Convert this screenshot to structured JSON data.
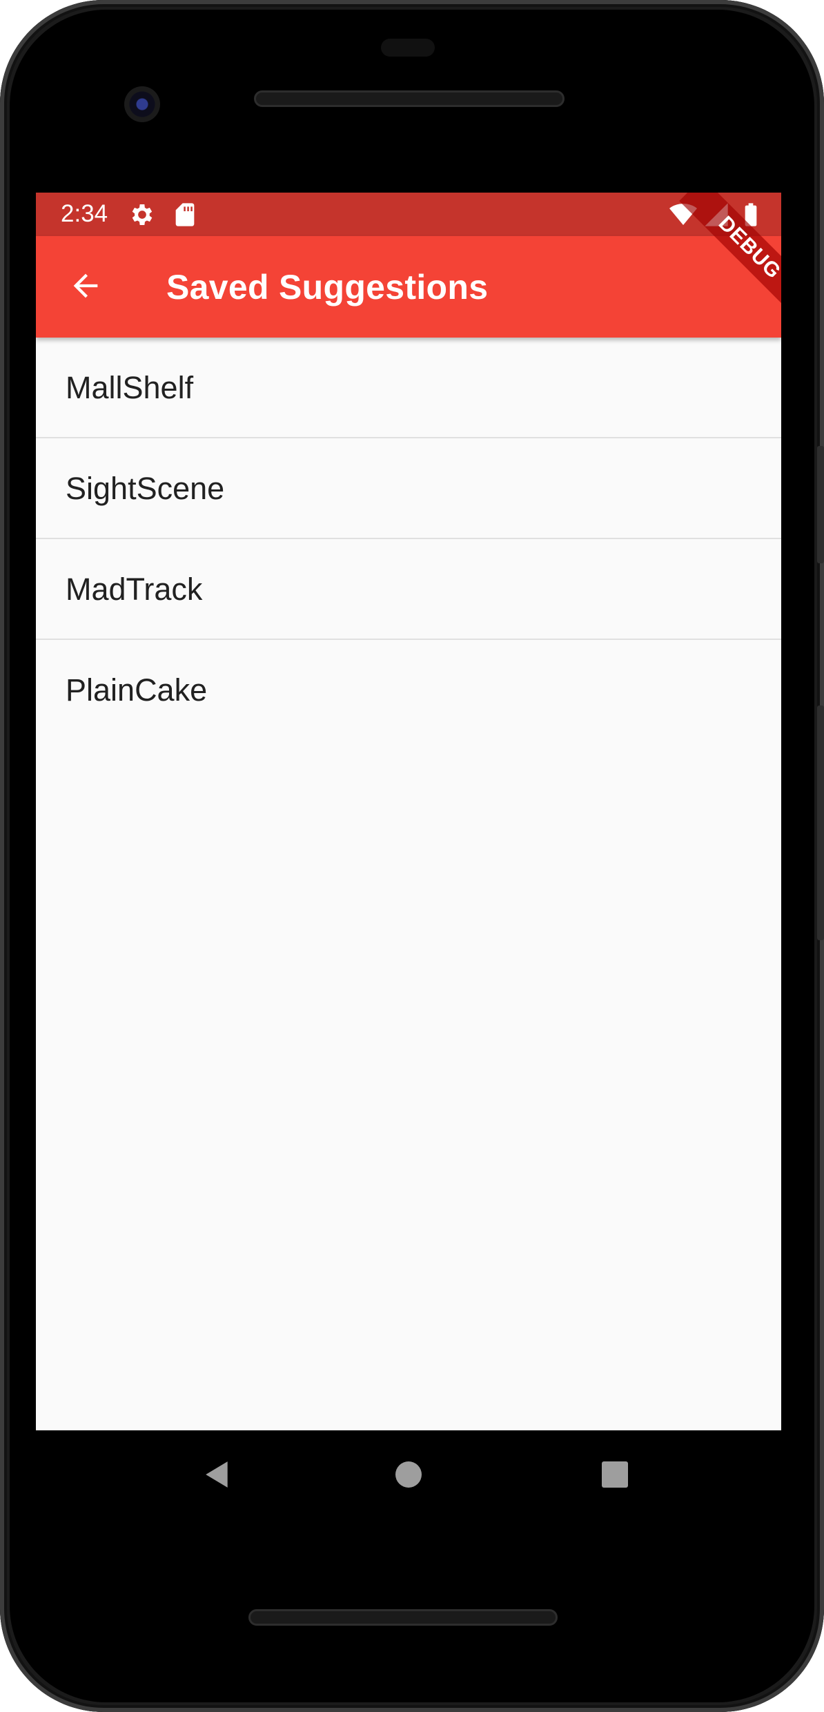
{
  "status_bar": {
    "time": "2:34",
    "icons": [
      "gear-icon",
      "sd-card-icon",
      "wifi-icon",
      "signal-icon",
      "battery-icon"
    ]
  },
  "app_bar": {
    "title": "Saved Suggestions",
    "back_icon": "arrow-back-icon",
    "color": "#f44336",
    "status_color": "#c5342c"
  },
  "debug_banner": {
    "label": "DEBUG"
  },
  "saved_list": {
    "items": [
      {
        "label": "MallShelf"
      },
      {
        "label": "SightScene"
      },
      {
        "label": "MadTrack"
      },
      {
        "label": "PlainCake"
      }
    ]
  },
  "nav_bar": {
    "buttons": [
      "back-triangle-icon",
      "home-circle-icon",
      "recents-square-icon"
    ]
  }
}
